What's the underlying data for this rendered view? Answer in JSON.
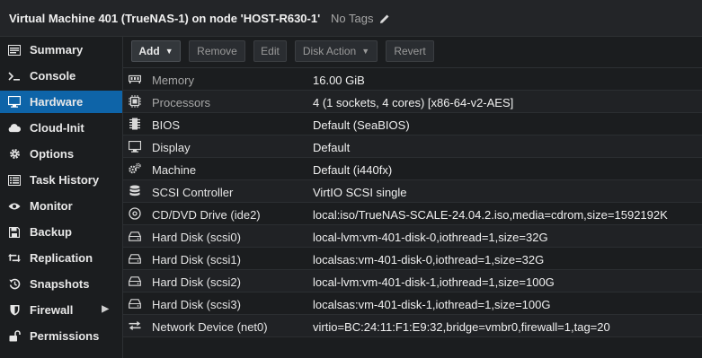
{
  "header": {
    "title": "Virtual Machine 401 (TrueNAS-1) on node 'HOST-R630-1'",
    "tags_label": "No Tags",
    "edit_icon": "pencil-icon"
  },
  "sidebar": {
    "items": [
      {
        "label": "Summary",
        "icon": "summary-icon"
      },
      {
        "label": "Console",
        "icon": "console-icon"
      },
      {
        "label": "Hardware",
        "icon": "monitor-icon",
        "active": true
      },
      {
        "label": "Cloud-Init",
        "icon": "cloud-icon"
      },
      {
        "label": "Options",
        "icon": "gear-icon"
      },
      {
        "label": "Task History",
        "icon": "list-icon"
      },
      {
        "label": "Monitor",
        "icon": "eye-icon"
      },
      {
        "label": "Backup",
        "icon": "floppy-icon"
      },
      {
        "label": "Replication",
        "icon": "retweet-icon"
      },
      {
        "label": "Snapshots",
        "icon": "history-icon"
      },
      {
        "label": "Firewall",
        "icon": "shield-icon",
        "has_submenu": true
      },
      {
        "label": "Permissions",
        "icon": "unlock-icon"
      }
    ]
  },
  "toolbar": {
    "add_label": "Add",
    "remove_label": "Remove",
    "edit_label": "Edit",
    "disk_action_label": "Disk Action",
    "revert_label": "Revert"
  },
  "hardware": {
    "rows": [
      {
        "label": "Memory",
        "value": "16.00 GiB",
        "icon": "memory-icon",
        "dim": true
      },
      {
        "label": "Processors",
        "value": "4 (1 sockets, 4 cores) [x86-64-v2-AES]",
        "icon": "cpu-icon",
        "dim": true
      },
      {
        "label": "BIOS",
        "value": "Default (SeaBIOS)",
        "icon": "chip-icon"
      },
      {
        "label": "Display",
        "value": "Default",
        "icon": "display-icon"
      },
      {
        "label": "Machine",
        "value": "Default (i440fx)",
        "icon": "cogs-icon"
      },
      {
        "label": "SCSI Controller",
        "value": "VirtIO SCSI single",
        "icon": "database-icon"
      },
      {
        "label": "CD/DVD Drive (ide2)",
        "value": "local:iso/TrueNAS-SCALE-24.04.2.iso,media=cdrom,size=1592192K",
        "icon": "cdrom-icon"
      },
      {
        "label": "Hard Disk (scsi0)",
        "value": "local-lvm:vm-401-disk-0,iothread=1,size=32G",
        "icon": "hdd-icon"
      },
      {
        "label": "Hard Disk (scsi1)",
        "value": "localsas:vm-401-disk-0,iothread=1,size=32G",
        "icon": "hdd-icon"
      },
      {
        "label": "Hard Disk (scsi2)",
        "value": "local-lvm:vm-401-disk-1,iothread=1,size=100G",
        "icon": "hdd-icon"
      },
      {
        "label": "Hard Disk (scsi3)",
        "value": "localsas:vm-401-disk-1,iothread=1,size=100G",
        "icon": "hdd-icon"
      },
      {
        "label": "Network Device (net0)",
        "value": "virtio=BC:24:11:F1:E9:32,bridge=vmbr0,firewall=1,tag=20",
        "icon": "exchange-icon"
      }
    ]
  },
  "colors": {
    "accent": "#0e64a8",
    "background": "#1b1d1f",
    "row_alt": "#202225"
  }
}
